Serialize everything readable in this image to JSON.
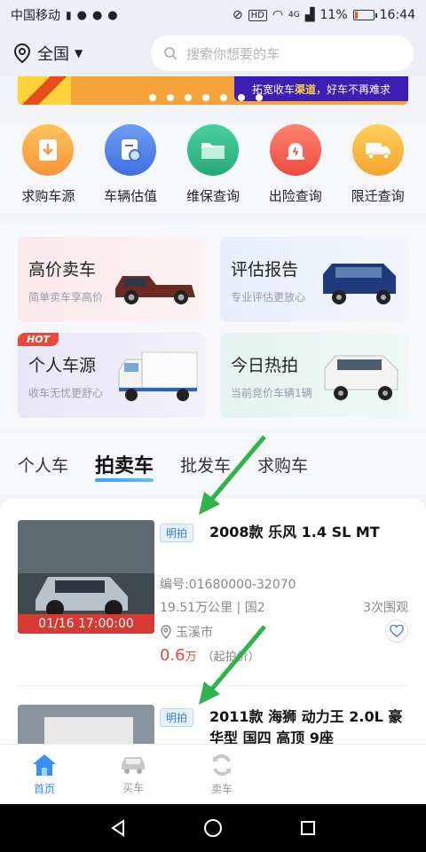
{
  "status": {
    "carrier": "中国移动",
    "battery": "11%",
    "time": "16:44",
    "network": "4G"
  },
  "header": {
    "location": "全国",
    "search_placeholder": "搜索你想要的车"
  },
  "banner": {
    "text_pre": "拓宽收车",
    "text_highlight": "渠道",
    "text_post": "，好车不再难求"
  },
  "quick": [
    {
      "label": "求购车源",
      "icon": "download-icon",
      "color": "#f6a43a"
    },
    {
      "label": "车辆估值",
      "icon": "valuation-icon",
      "color": "#3f7be6"
    },
    {
      "label": "维保查询",
      "icon": "folder-icon",
      "color": "#2fbf8a"
    },
    {
      "label": "出险查询",
      "icon": "alarm-icon",
      "color": "#f25a4a"
    },
    {
      "label": "限迁查询",
      "icon": "truck-icon",
      "color": "#f6b13a"
    }
  ],
  "cards": [
    {
      "title": "高价卖车",
      "sub": "简单卖车享高价"
    },
    {
      "title": "评估报告",
      "sub": "专业评估更放心"
    },
    {
      "title": "个人车源",
      "sub": "收车无忧更舒心",
      "hot": "HOT"
    },
    {
      "title": "今日热拍",
      "sub": "当前竞价车辆1辆"
    }
  ],
  "tabs": [
    "个人车",
    "拍卖车",
    "批发车",
    "求购车"
  ],
  "listings": [
    {
      "badge": "明拍",
      "title": "2008款 乐风 1.4 SL MT",
      "code": "编号:01680000-32070",
      "mileage": "19.51万公里 | 国2",
      "views": "3次围观",
      "city": "玉溪市",
      "price": "0.6",
      "unit": "万",
      "price_note": "（起拍价）",
      "time": "01/16 17:00:00"
    },
    {
      "badge": "明拍",
      "title": "2011款 海狮 动力王 2.0L 豪华型 国四 高顶 9座"
    }
  ],
  "bottom_nav": [
    {
      "label": "首页",
      "icon": "home-icon",
      "active": true
    },
    {
      "label": "买车",
      "icon": "car-icon",
      "active": false
    },
    {
      "label": "卖车",
      "icon": "refresh-icon",
      "active": false
    }
  ]
}
